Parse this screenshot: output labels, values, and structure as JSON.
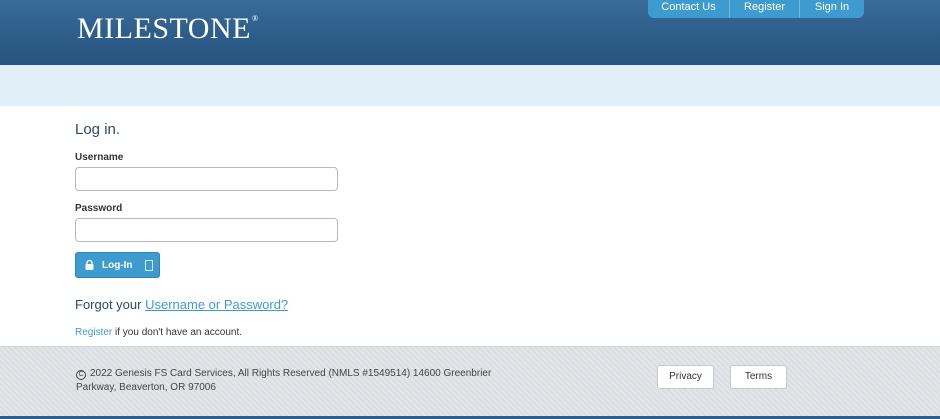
{
  "header": {
    "logo_text": "MILESTONE",
    "logo_mark": "®",
    "nav": {
      "contact_label": "Contact Us",
      "register_label": "Register",
      "signin_label": "Sign In"
    }
  },
  "login": {
    "title": "Log in.",
    "username_label": "Username",
    "username_value": "",
    "password_label": "Password",
    "password_value": "",
    "button_label": "Log-In",
    "forgot_prefix": "Forgot your ",
    "forgot_link": "Username or Password?",
    "register_link": "Register",
    "register_suffix": " if you don't have an account."
  },
  "footer": {
    "copyright_symbol": "C",
    "copyright_text": "2022  Genesis FS Card Services, All Rights Reserved (NMLS #1549514) 14600 Greenbrier Parkway, Beaverton, OR 97006",
    "privacy_label": "Privacy",
    "terms_label": "Terms"
  },
  "colors": {
    "header": "#2d5d8a",
    "accent": "#3d9bcf",
    "band": "#e0eff8",
    "title": "#2c4a6b"
  },
  "icons": {
    "login_button_left": "lock-icon",
    "login_button_right": "box-icon",
    "footer": "copyright-icon"
  }
}
